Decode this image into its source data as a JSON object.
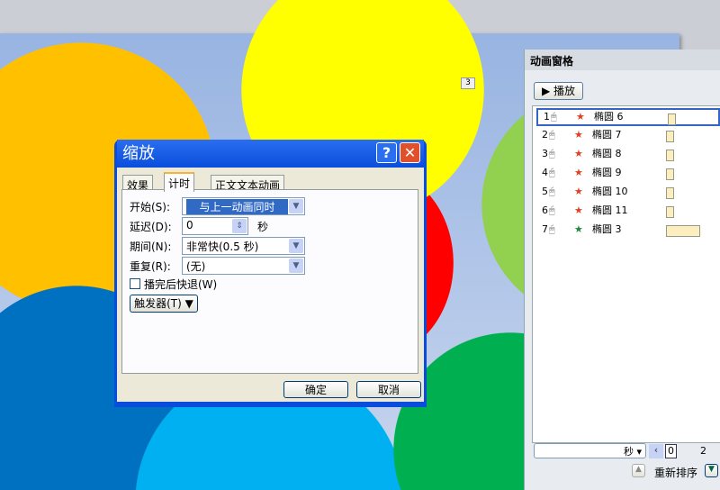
{
  "slide": {
    "badge": "3"
  },
  "dialog": {
    "title": "缩放",
    "help": "?",
    "close": "✕",
    "tabs": [
      "效果",
      "计时",
      "正文文本动画"
    ],
    "start_label": "开始(S):",
    "start_value": "与上一动画同时",
    "delay_label": "延迟(D):",
    "delay_value": "0",
    "delay_unit": "秒",
    "duration_label": "期间(N):",
    "duration_value": "非常快(0.5 秒)",
    "repeat_label": "重复(R):",
    "repeat_value": "(无)",
    "rewind_label": "播完后快退(W)",
    "trigger_label": "触发器(T)",
    "ok": "确定",
    "cancel": "取消"
  },
  "panel": {
    "title": "动画窗格",
    "play": "播放",
    "items": [
      {
        "num": "1",
        "name": "椭圆 6",
        "type": "emphasis"
      },
      {
        "num": "2",
        "name": "椭圆 7",
        "type": "emphasis"
      },
      {
        "num": "3",
        "name": "椭圆 8",
        "type": "emphasis"
      },
      {
        "num": "4",
        "name": "椭圆 9",
        "type": "emphasis"
      },
      {
        "num": "5",
        "name": "椭圆 10",
        "type": "emphasis"
      },
      {
        "num": "6",
        "name": "椭圆 11",
        "type": "emphasis"
      },
      {
        "num": "7",
        "name": "椭圆 3",
        "type": "entrance"
      }
    ],
    "seconds_label": "秒",
    "timeline_0": "0",
    "timeline_2": "2",
    "reorder": "重新排序"
  }
}
